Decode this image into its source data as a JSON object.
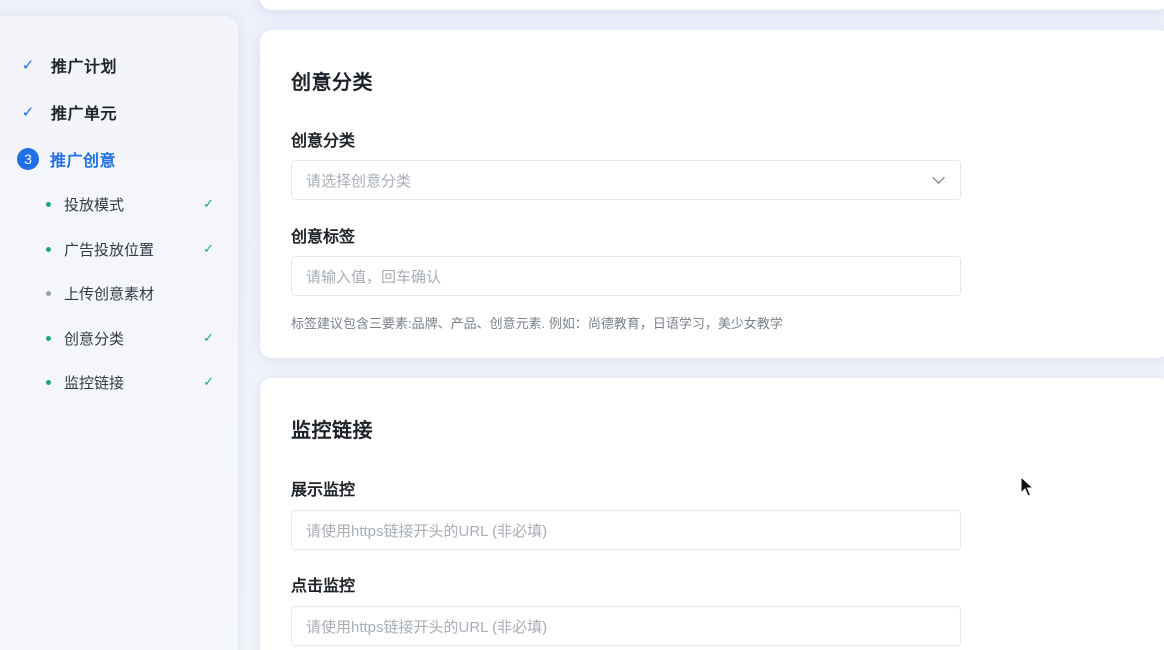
{
  "sidebar": {
    "steps": [
      {
        "label": "推广计划",
        "state": "done"
      },
      {
        "label": "推广单元",
        "state": "done"
      },
      {
        "label": "推广创意",
        "state": "active",
        "number": "3"
      }
    ],
    "sub_items": [
      {
        "label": "投放模式",
        "done": true
      },
      {
        "label": "广告投放位置",
        "done": true
      },
      {
        "label": "上传创意素材",
        "done": false
      },
      {
        "label": "创意分类",
        "done": true
      },
      {
        "label": "监控链接",
        "done": true
      }
    ]
  },
  "creative_category": {
    "title": "创意分类",
    "category_label": "创意分类",
    "category_placeholder": "请选择创意分类",
    "tags_label": "创意标签",
    "tags_placeholder": "请输入值，回车确认",
    "tags_hint": "标签建议包含三要素:品牌、产品、创意元素. 例如：尚德教育，日语学习，美少女教学"
  },
  "monitor_link": {
    "title": "监控链接",
    "impression_label": "展示监控",
    "impression_placeholder": "请使用https链接开头的URL (非必填)",
    "click_label": "点击监控",
    "click_placeholder": "请使用https链接开头的URL (非必填)"
  },
  "colors": {
    "accent": "#1f6fe5",
    "done_check": "#19a57b"
  },
  "icons": {
    "done": "check-icon",
    "dropdown": "chevron-down-icon",
    "pointer": "mouse-cursor-icon"
  }
}
